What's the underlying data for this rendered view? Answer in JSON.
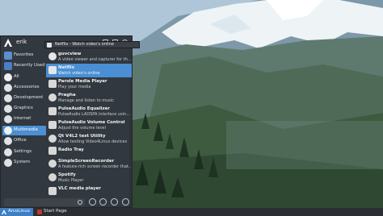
{
  "menu": {
    "username": "erik",
    "categories": [
      {
        "label": "Favorites"
      },
      {
        "label": "Recently Used"
      },
      {
        "label": "All"
      },
      {
        "label": "Accessories"
      },
      {
        "label": "Development"
      },
      {
        "label": "Graphics"
      },
      {
        "label": "Internet"
      },
      {
        "label": "Multimedia"
      },
      {
        "label": "Office"
      },
      {
        "label": "Settings"
      },
      {
        "label": "System"
      }
    ],
    "apps": [
      {
        "name": "guvcview",
        "desc": "A video viewer and capturer for th..."
      },
      {
        "name": "Netflix",
        "desc": "Watch video's online"
      },
      {
        "name": "Parole Media Player",
        "desc": "Play your media"
      },
      {
        "name": "Pragha",
        "desc": "Manage and listen to music"
      },
      {
        "name": "PulseAudio Equalizer",
        "desc": "PulseAudio LADSPA interface usin..."
      },
      {
        "name": "PulseAudio Volume Control",
        "desc": "Adjust the volume level"
      },
      {
        "name": "Qt V4L2 test Utility",
        "desc": "Allow testing Video4Linux devices"
      },
      {
        "name": "Radio Tray",
        "desc": ""
      },
      {
        "name": "SimpleScreenRecorder",
        "desc": "A feature-rich screen recorder that..."
      },
      {
        "name": "Spotify",
        "desc": "Music Player"
      },
      {
        "name": "VLC media player",
        "desc": ""
      }
    ],
    "tooltip": "Netflix - Watch video's online"
  },
  "taskbar": {
    "start_label": "ArcoLinux",
    "task_label": "Start Page"
  },
  "colors": {
    "accent": "#4c8fd2",
    "menu_bg": "#2d3238",
    "taskbar_bg": "#2b2f33"
  }
}
